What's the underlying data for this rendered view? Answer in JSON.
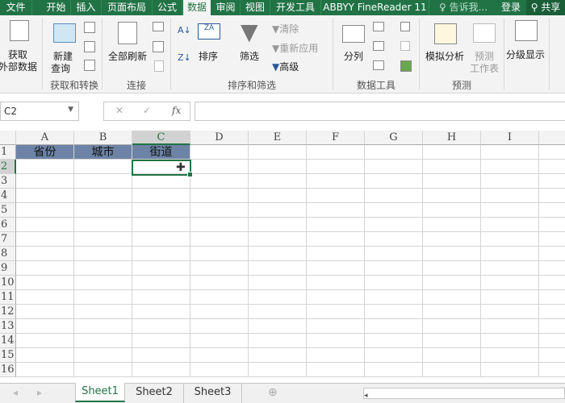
{
  "ribbon_tabs": [
    "文件",
    "开始",
    "插入",
    "页面布局",
    "公式",
    "数据",
    "审阅",
    "视图",
    "开发工具",
    "ABBYY FineReader 11"
  ],
  "active_tab": "数据",
  "tell_me": "告诉我...",
  "login": "登录",
  "share": "共享",
  "ribbon": {
    "get_external_data": [
      "获取",
      "外部数据"
    ],
    "new_query": [
      "新建",
      "查询"
    ],
    "refresh_all": "全部刷新",
    "sort": "排序",
    "filter": "筛选",
    "clear": "清除",
    "reapply": "重新应用",
    "advanced": "高级",
    "text_to_columns": "分列",
    "what_if": "模拟分析",
    "forecast_sheet": [
      "预测",
      "工作表"
    ],
    "outline": "分级显示",
    "groups": [
      "获取和转换",
      "连接",
      "排序和筛选",
      "数据工具",
      "预测"
    ]
  },
  "formula_bar": {
    "name_box": "C2",
    "formula": "",
    "fx": "fx"
  },
  "columns": [
    "A",
    "B",
    "C",
    "D",
    "E",
    "F",
    "G",
    "H",
    "I"
  ],
  "rows": [
    "1",
    "2",
    "3",
    "4",
    "5",
    "6",
    "7",
    "8",
    "9",
    "10",
    "11",
    "12",
    "13",
    "14",
    "15",
    "16"
  ],
  "cells": {
    "A1": "省份",
    "B1": "城市",
    "C1": "街道"
  },
  "selected_cell": "C2",
  "header_fill": "#6d83a6",
  "accent": "#217346",
  "sheets": [
    "Sheet1",
    "Sheet2",
    "Sheet3"
  ],
  "active_sheet": "Sheet1"
}
